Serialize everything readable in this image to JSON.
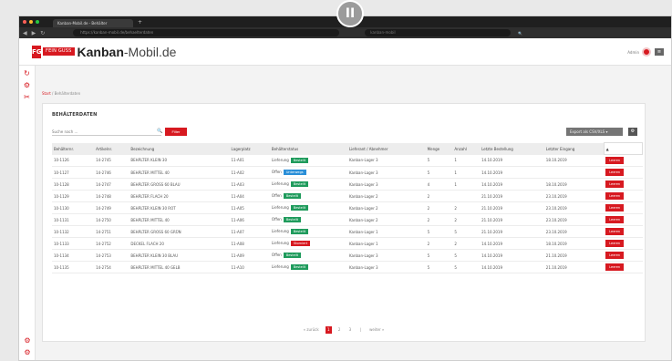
{
  "browser": {
    "tab_title": "Kanban-Mobil.de - Behälter",
    "new_tab": "+",
    "url": "https://kanban-mobil.de/behaelterdaten",
    "search_box": "kanban-mobil",
    "nav_icons": [
      "back-icon",
      "forward-icon",
      "reload-icon"
    ]
  },
  "overlay": {
    "pause_label": "II"
  },
  "header": {
    "logo_letter": "FG",
    "badge": "FEIN GUSS",
    "brand_bold": "Kanban",
    "brand_rest": "-Mobil.de",
    "user_name": "Admin",
    "menu_label": "≡"
  },
  "sidebar": {
    "icons": [
      "↻",
      "⚙",
      "✂"
    ],
    "bottom_icons": [
      "⚙",
      "⚙"
    ]
  },
  "breadcrumb": {
    "home": "Start",
    "separator": " / ",
    "current": "Behälterdaten"
  },
  "card": {
    "title": "BEHÄLTERDATEN",
    "search_placeholder": "Suche nach ...",
    "search_icon": "🔍",
    "search_button": "Filter",
    "export_button": "Export als CSV/XLS ▾",
    "settings_icon": "⚙"
  },
  "table": {
    "headers": [
      "Behälternr.",
      "Artikelnr.",
      "Bezeichnung",
      "Lagerplatz",
      "Behälterstatus",
      "Lieferant / Abnehmer",
      "Menge",
      "Anzahl",
      "Letzte Bestellung",
      "Letzter Eingang",
      "▲"
    ],
    "rows": [
      [
        "10-1126",
        "14-2745",
        "BEHÄLTER KLEIN 30",
        "11-A01",
        "Lieferung",
        "Kanban-Lager 3",
        "5",
        "1",
        "14.10.2019",
        "18.10.2019",
        "Leeren",
        "Bestellt",
        "#1f9b5c"
      ],
      [
        "10-1127",
        "14-2746",
        "BEHÄLTER MITTEL 40",
        "11-A02",
        "Offen",
        "Kanban-Lager 3",
        "5",
        "1",
        "14.10.2019",
        "",
        "Leeren",
        "Unterwegs",
        "#2a8fd8"
      ],
      [
        "10-1128",
        "14-2747",
        "BEHÄLTER GROSS 60 BLAU",
        "11-A03",
        "Lieferung",
        "Kanban-Lager 3",
        "4",
        "1",
        "14.10.2019",
        "18.10.2019",
        "Leeren",
        "Bestellt",
        "#1f9b5c"
      ],
      [
        "10-1129",
        "14-2748",
        "BEHÄLTER FLACH 20",
        "11-A04",
        "Offen",
        "Kanban-Lager 2",
        "2",
        "",
        "21.10.2019",
        "23.10.2019",
        "Leeren",
        "Bestellt",
        "#1f9b5c"
      ],
      [
        "10-1130",
        "14-2749",
        "BEHÄLTER KLEIN 30 ROT",
        "11-A05",
        "Lieferung",
        "Kanban-Lager 2",
        "2",
        "2",
        "21.10.2019",
        "23.10.2019",
        "Leeren",
        "Bestellt",
        "#1f9b5c"
      ],
      [
        "10-1131",
        "14-2750",
        "BEHÄLTER MITTEL 40",
        "11-A06",
        "Offen",
        "Kanban-Lager 2",
        "2",
        "2",
        "21.10.2019",
        "23.10.2019",
        "Leeren",
        "Bestellt",
        "#1f9b5c"
      ],
      [
        "10-1132",
        "14-2751",
        "BEHÄLTER GROSS 60 GRÜN",
        "11-A07",
        "Lieferung",
        "Kanban-Lager 1",
        "5",
        "5",
        "21.10.2019",
        "23.10.2019",
        "Leeren",
        "Bestellt",
        "#1f9b5c"
      ],
      [
        "10-1133",
        "14-2752",
        "DECKEL FLACH 20",
        "11-A08",
        "Lieferung",
        "Kanban-Lager 1",
        "2",
        "2",
        "14.10.2019",
        "18.10.2019",
        "Leeren",
        "Storniert",
        "#d71920"
      ],
      [
        "10-1134",
        "14-2753",
        "BEHÄLTER KLEIN 30 BLAU",
        "11-A09",
        "Offen",
        "Kanban-Lager 3",
        "5",
        "5",
        "14.10.2019",
        "21.10.2019",
        "Leeren",
        "Bestellt",
        "#1f9b5c"
      ],
      [
        "10-1135",
        "14-2754",
        "BEHÄLTER MITTEL 40 GELB",
        "11-A10",
        "Lieferung",
        "Kanban-Lager 3",
        "5",
        "5",
        "14.10.2019",
        "21.10.2019",
        "Leeren",
        "Bestellt",
        "#1f9b5c"
      ]
    ]
  },
  "pager": {
    "prev": "« zurück",
    "pages": [
      "1",
      "2",
      "3"
    ],
    "active": "1",
    "sep": "|",
    "next": "weiter »"
  },
  "colors": {
    "accent": "#d71920",
    "green": "#1f9b5c",
    "blue": "#2a8fd8"
  }
}
